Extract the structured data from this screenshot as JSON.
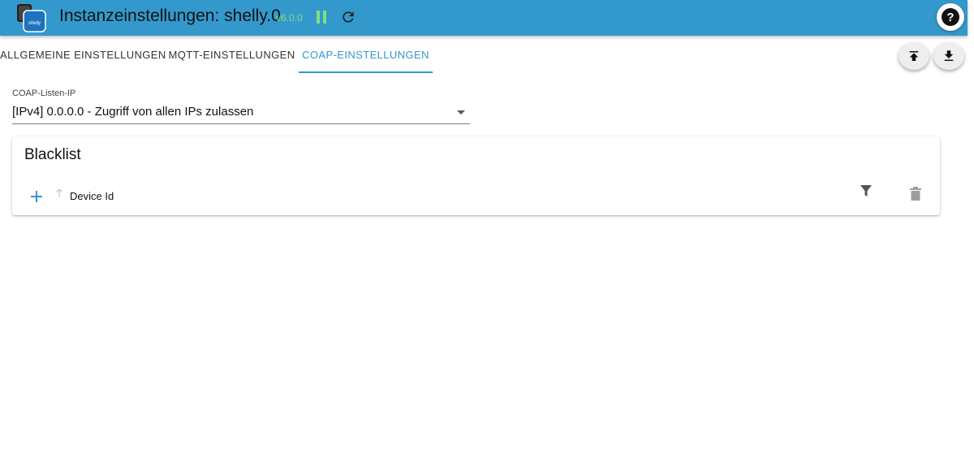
{
  "header": {
    "title": "Instanzeinstellungen: shelly.0",
    "version": "v6.0.0",
    "logo_text": "shelly",
    "icons": {
      "logo": "shelly-adapter-logo",
      "pause": "pause-icon",
      "refresh": "refresh-icon",
      "help": "help-icon"
    },
    "colors": {
      "bar": "#3399cc",
      "version": "#7ee07e"
    }
  },
  "tabs": [
    {
      "label": "ALLGEMEINE EINSTELLUNGEN",
      "active": false
    },
    {
      "label": "MQTT-EINSTELLUNGEN",
      "active": false
    },
    {
      "label": "COAP-EINSTELLUNGEN",
      "active": true
    }
  ],
  "actions": {
    "icons": [
      "upload-icon",
      "download-icon"
    ]
  },
  "coap": {
    "listen_ip_label": "COAP-Listen-IP",
    "listen_ip_value": "[IPv4] 0.0.0.0 - Zugriff von allen IPs zulassen"
  },
  "blacklist": {
    "title": "Blacklist",
    "column": "Device Id",
    "icons": [
      "add-icon",
      "sort-arrow-icon",
      "filter-icon",
      "delete-icon"
    ]
  }
}
